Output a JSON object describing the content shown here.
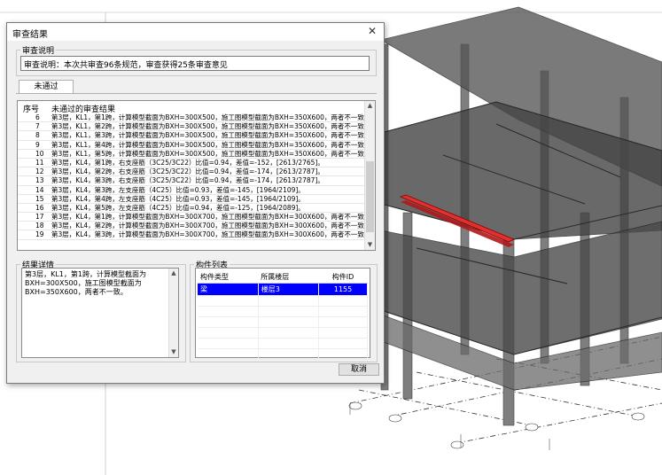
{
  "dialog": {
    "title": "审查结果",
    "description_label": "审查说明",
    "description_value": "审查说明：本次共审查96条规范，审查获得25条审查意见",
    "tab_label": "未通过",
    "list_headers": {
      "seq": "序号",
      "result": "未通过的审查结果"
    },
    "rows": [
      {
        "n": "6",
        "text": "第3层，KL1，第1跨，计算模型截面为BXH=300X500，施工图模型截面为BXH=350X600，两者不一致。"
      },
      {
        "n": "7",
        "text": "第3层，KL1，第2跨，计算模型截面为BXH=300X500，施工图模型截面为BXH=350X600，两者不一致。"
      },
      {
        "n": "8",
        "text": "第3层，KL1，第3跨，计算模型截面为BXH=300X500，施工图模型截面为BXH=350X600，两者不一致。"
      },
      {
        "n": "9",
        "text": "第3层，KL1，第4跨，计算模型截面为BXH=300X500，施工图模型截面为BXH=350X600，两者不一致。"
      },
      {
        "n": "10",
        "text": "第3层，KL1，第5跨，计算模型截面为BXH=300X500，施工图模型截面为BXH=350X600，两者不一致。"
      },
      {
        "n": "11",
        "text": "第3层，KL4，第1跨，右支座筋（3C25/3C22）比值=0.94，差值=-152，[2613/2765]。"
      },
      {
        "n": "12",
        "text": "第3层，KL4，第2跨，右支座筋（3C25/3C22）比值=0.94，差值=-174，[2613/2787]。"
      },
      {
        "n": "13",
        "text": "第3层，KL4，第3跨，右支座筋（3C25/3C22）比值=0.94，差值=-174，[2613/2787]。"
      },
      {
        "n": "14",
        "text": "第3层，KL4，第3跨，左支座筋（4C25）比值=0.93，差值=-145，[1964/2109]。"
      },
      {
        "n": "15",
        "text": "第3层，KL4，第4跨，左支座筋（4C25）比值=0.93，差值=-145，[1964/2109]。"
      },
      {
        "n": "16",
        "text": "第3层，KL4，第5跨，左支座筋（4C25）比值=0.94，差值=-125，[1964/2089]。"
      },
      {
        "n": "17",
        "text": "第3层，KL4，第1跨，计算模型截面为BXH=300X700，施工图模型截面为BXH=300X600，两者不一致。"
      },
      {
        "n": "18",
        "text": "第3层，KL4，第2跨，计算模型截面为BXH=300X700，施工图模型截面为BXH=300X600，两者不一致。"
      },
      {
        "n": "19",
        "text": "第3层，KL4，第3跨，计算模型截面为BXH=300X700，施工图模型截面为BXH=300X600，两者不一致。"
      }
    ],
    "detail_label": "结果详情",
    "detail_lines": [
      "第3层，KL1，第1跨，计算模型截面为",
      "BXH=300X500，施工图模型截面为",
      "BXH=350X600，两者不一致。"
    ],
    "components_label": "构件列表",
    "components_headers": {
      "type": "构件类型",
      "floor": "所属楼层",
      "id": "构件ID"
    },
    "components": [
      {
        "type": "梁",
        "floor": "楼层3",
        "id": "1155"
      }
    ],
    "cancel_label": "取消"
  },
  "colors": {
    "highlight": "#e03030",
    "selection": "#0000ff"
  }
}
